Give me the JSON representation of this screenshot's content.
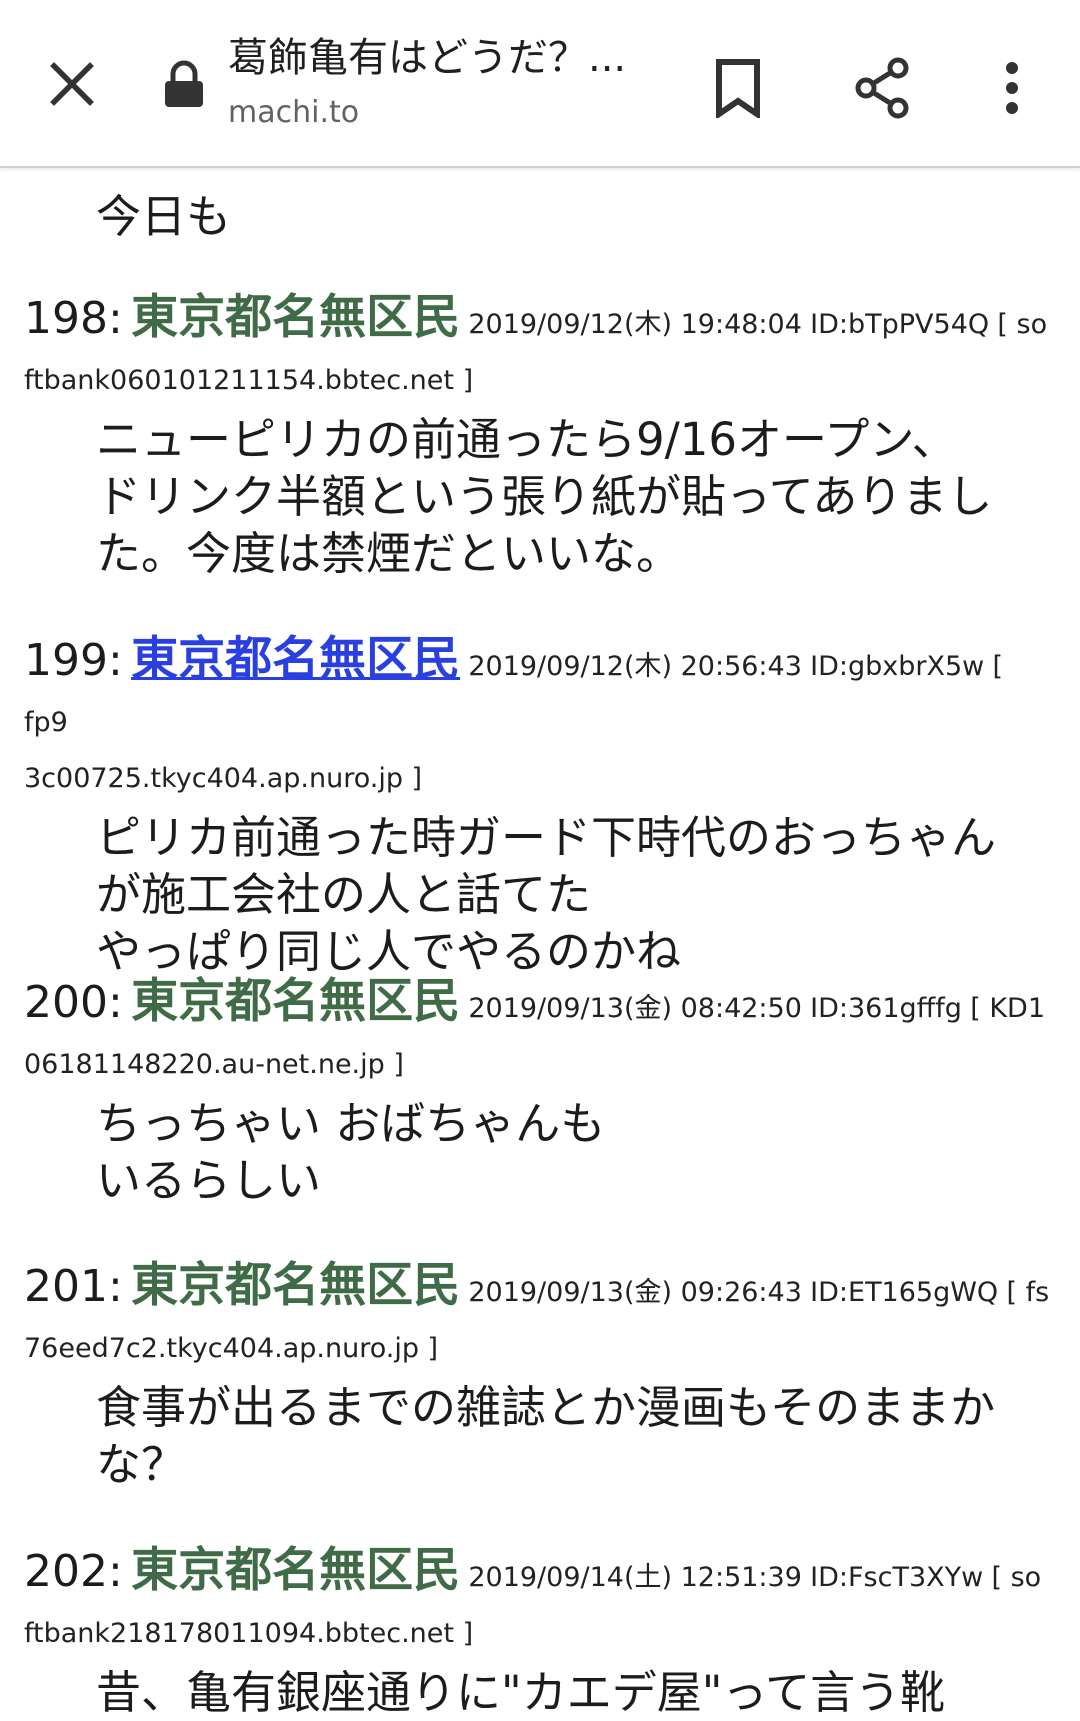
{
  "toolbar": {
    "title": "葛飾亀有はどうだ？...",
    "domain": "machi.to"
  },
  "top_fragment": "今日も",
  "posts": [
    {
      "num": "198:",
      "name": "東京都名無区民",
      "datetime": "2019/09/12(木) 19:48:04",
      "id": "ID:bTpPV54Q",
      "host_start": "[ so",
      "host_rest": "ftbank060101211154.bbtec.net ]",
      "body": "ニューピリカの前通ったら9/16オープン、\nドリンク半額という張り紙が貼ってありまし\nた。今度は禁煙だといいな。"
    },
    {
      "num": "199:",
      "name": "東京都名無区民",
      "datetime": "2019/09/12(木) 20:56:43",
      "id": "ID:gbxbrX5w",
      "host_start": "[ fp9",
      "host_rest": "3c00725.tkyc404.ap.nuro.jp ]",
      "body": "ピリカ前通った時ガード下時代のおっちゃん\nが施工会社の人と話てた\nやっぱり同じ人でやるのかね"
    },
    {
      "num": "200:",
      "name": "東京都名無区民",
      "datetime": "2019/09/13(金) 08:42:50",
      "id": "ID:361gfffg",
      "host_start": "[ KD1",
      "host_rest": "06181148220.au-net.ne.jp ]",
      "body": "ちっちゃい おばちゃんも\nいるらしい"
    },
    {
      "num": "201:",
      "name": "東京都名無区民",
      "datetime": "2019/09/13(金) 09:26:43",
      "id": "ID:ET165gWQ",
      "host_start": "[ fs",
      "host_rest": "76eed7c2.tkyc404.ap.nuro.jp ]",
      "body": "食事が出るまでの雑誌とか漫画もそのままか\nな？"
    },
    {
      "num": "202:",
      "name": "東京都名無区民",
      "datetime": "2019/09/14(土) 12:51:39",
      "id": "ID:FscT3XYw",
      "host_start": "[ so",
      "host_rest": "ftbank218178011094.bbtec.net ]",
      "body": "昔、亀有銀座通りに\"カエデ屋\"って言う靴"
    }
  ],
  "colors": {
    "name_green": "#3f6b46",
    "link_blue": "#2a3fe0"
  },
  "icons": [
    "close-icon",
    "lock-icon",
    "bookmark-icon",
    "share-icon",
    "more-vert-icon"
  ]
}
